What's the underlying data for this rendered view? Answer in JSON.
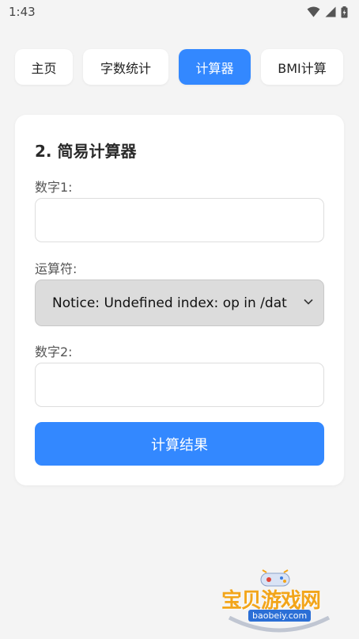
{
  "status_bar": {
    "time": "1:43"
  },
  "tabs": [
    {
      "label": "主页",
      "active": false
    },
    {
      "label": "字数统计",
      "active": false
    },
    {
      "label": "计算器",
      "active": true
    },
    {
      "label": "BMI计算",
      "active": false
    }
  ],
  "calculator": {
    "title": "2. 简易计算器",
    "number1_label": "数字1:",
    "number1_value": "",
    "operator_label": "运算符:",
    "operator_selected": "Notice: Undefined index: op in /dat",
    "number2_label": "数字2:",
    "number2_value": "",
    "submit_label": "计算结果"
  },
  "watermark": {
    "brand_cn": "宝贝游戏网",
    "brand_url": "baobeiy.com"
  },
  "colors": {
    "accent": "#3388ff",
    "background": "#f4f4f4",
    "watermark": "#f2a51a"
  },
  "icons": [
    "wifi-icon",
    "cellular-signal-icon",
    "battery-icon",
    "chevron-down-icon",
    "gamepad-icon"
  ]
}
